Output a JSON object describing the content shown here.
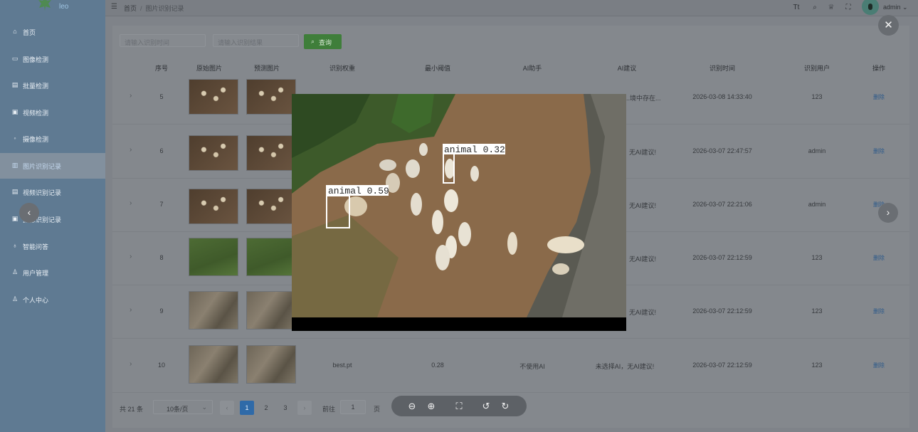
{
  "app": {
    "logo_text": "leo"
  },
  "sidebar": {
    "items": [
      {
        "label": "首页",
        "icon": "home-icon"
      },
      {
        "label": "图像检测",
        "icon": "image-icon"
      },
      {
        "label": "批量检测",
        "icon": "batch-icon"
      },
      {
        "label": "视频检测",
        "icon": "video-icon"
      },
      {
        "label": "摄像检测",
        "icon": "camera-icon"
      },
      {
        "label": "图片识别记录",
        "icon": "record-icon",
        "active": true
      },
      {
        "label": "视频识别记录",
        "icon": "record-icon"
      },
      {
        "label": "摄像识别记录",
        "icon": "record-icon"
      },
      {
        "label": "智能问答",
        "icon": "chat-icon"
      },
      {
        "label": "用户管理",
        "icon": "user-icon"
      },
      {
        "label": "个人中心",
        "icon": "profile-icon"
      }
    ]
  },
  "header": {
    "breadcrumb_home": "首页",
    "breadcrumb_sep": "/",
    "breadcrumb_current": "图片识别记录",
    "username": "admin"
  },
  "search": {
    "time_placeholder": "请输入识别时间",
    "result_placeholder": "请输入识别结果",
    "query_label": "查询"
  },
  "table": {
    "headers": [
      "序号",
      "原始图片",
      "预测图片",
      "识别权重",
      "最小阈值",
      "AI助手",
      "AI建议",
      "识别时间",
      "识别用户",
      "操作"
    ],
    "rows": [
      {
        "index": "5",
        "thumb": "sheep",
        "ai_suggestion": "...境中存在...",
        "time": "2026-03-08 14:33:40",
        "user": "123",
        "action": "删除"
      },
      {
        "index": "6",
        "thumb": "sheep",
        "ai_suggestion": "无AI建议!",
        "time": "2026-03-07 22:47:57",
        "user": "admin",
        "action": "删除"
      },
      {
        "index": "7",
        "thumb": "sheep",
        "ai_suggestion": "无AI建议!",
        "time": "2026-03-07 22:21:06",
        "user": "admin",
        "action": "删除"
      },
      {
        "index": "8",
        "thumb": "grass",
        "ai_suggestion": "无AI建议!",
        "time": "2026-03-07 22:12:59",
        "user": "123",
        "action": "删除"
      },
      {
        "index": "9",
        "thumb": "aerial",
        "ai_suggestion": "无AI建议!",
        "time": "2026-03-07 22:12:59",
        "user": "123",
        "action": "删除"
      },
      {
        "index": "10",
        "thumb": "aerial",
        "weight": "best.pt",
        "threshold": "0.28",
        "ai_helper": "不使用AI",
        "ai_suggestion": "未选择AI，无AI建议!",
        "time": "2026-03-07 22:12:59",
        "user": "123",
        "action": "删除"
      }
    ]
  },
  "pagination": {
    "total": "共 21 条",
    "page_size": "10条/页",
    "pages": [
      "1",
      "2",
      "3"
    ],
    "current_page": "1",
    "goto_label": "前往",
    "goto_value": "1",
    "page_unit": "页"
  },
  "viewer": {
    "detections": [
      {
        "label": "animal",
        "score": "0.59"
      },
      {
        "label": "animal",
        "score": "0.32"
      }
    ],
    "box_color": "#ffffff"
  },
  "colors": {
    "sidebar_bg": "#5f7a92",
    "active_menu": "#82909e",
    "query_button": "#3f7e3a",
    "pagination_active": "#2f6aa8"
  }
}
